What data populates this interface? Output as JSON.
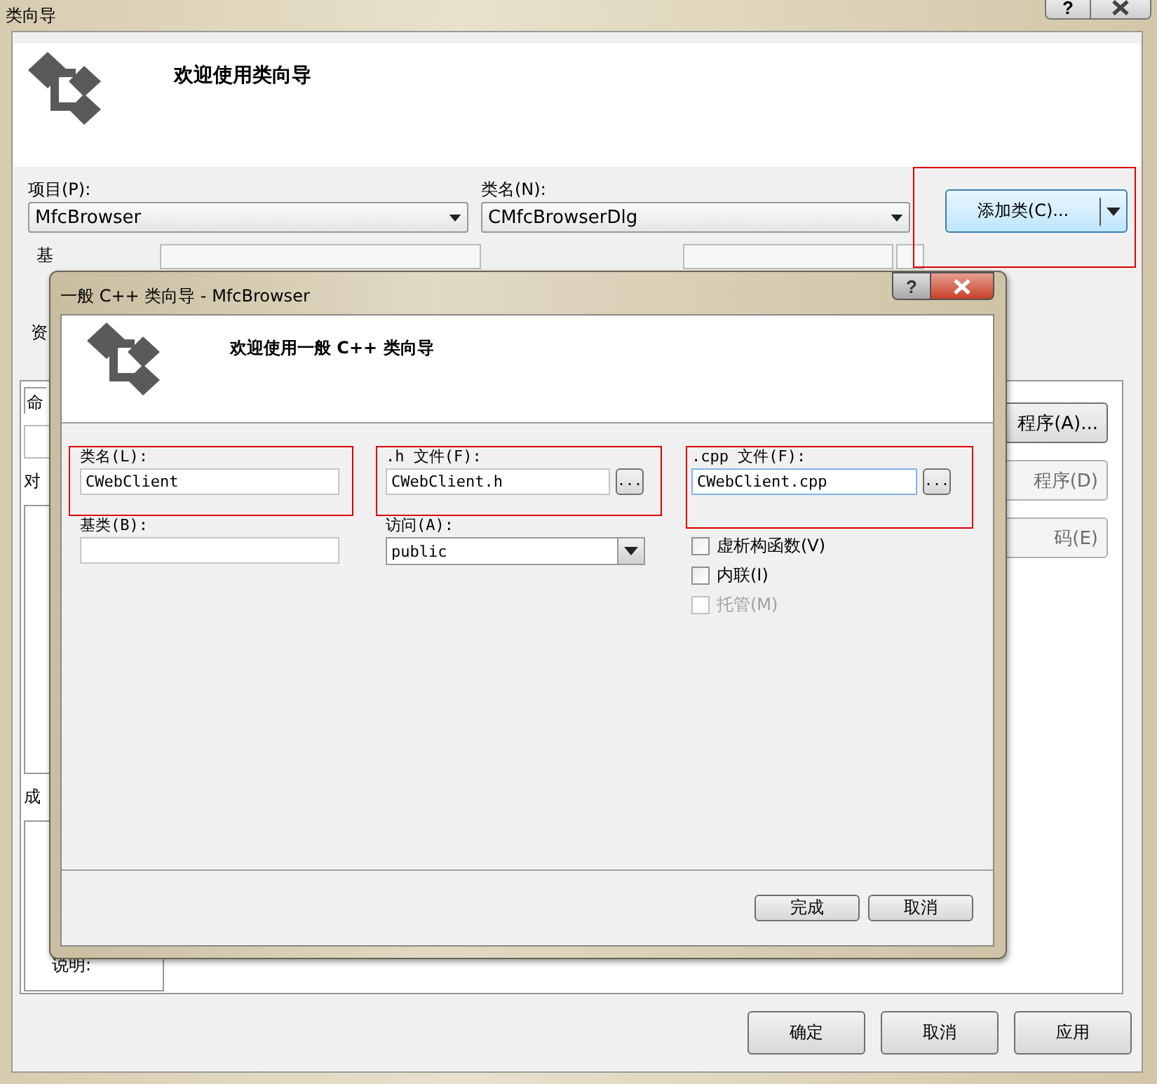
{
  "window": {
    "title": "类向导",
    "help_button": "?"
  },
  "header": {
    "title": "欢迎使用类向导"
  },
  "project": {
    "label": "项目(P):",
    "value": "MfcBrowser"
  },
  "class_name": {
    "label": "类名(N):",
    "value": "CMfcBrowserDlg"
  },
  "add_class_button": {
    "label": "添加类(C)..."
  },
  "fragments": {
    "base_class_label": "基",
    "resources_label": "资",
    "tab": "命",
    "objects_label": "对",
    "members_label": "成"
  },
  "side_buttons": [
    {
      "label": "程序(A)...",
      "disabled": false
    },
    {
      "label": "程序(D)",
      "disabled": true
    },
    {
      "label": "码(E)",
      "disabled": true
    }
  ],
  "description_label": "说明:",
  "buttons": [
    {
      "label": "确定"
    },
    {
      "label": "取消"
    },
    {
      "label": "应用"
    }
  ],
  "dialog": {
    "title": "一般 C++ 类向导 - MfcBrowser",
    "help_button": "?",
    "header": "欢迎使用一般 C++ 类向导",
    "class_name": {
      "label": "类名(L):",
      "value": "CWebClient"
    },
    "base_class": {
      "label": "基类(B):"
    },
    "h_file": {
      "label": ".h 文件(F):",
      "value": "CWebClient.h",
      "browse": "..."
    },
    "access": {
      "label": "访问(A):",
      "value": "public"
    },
    "cpp_file": {
      "label": ".cpp 文件(F):",
      "value": "CWebClient.cpp",
      "browse": "...",
      "focused": true
    },
    "options": [
      {
        "label": "虚析构函数(V)",
        "checked": false,
        "disabled": false
      },
      {
        "label": "内联(I)",
        "checked": false,
        "disabled": false
      },
      {
        "label": "托管(M)",
        "checked": false,
        "disabled": true
      }
    ],
    "buttons": [
      {
        "label": "完成"
      },
      {
        "label": "取消"
      }
    ]
  }
}
